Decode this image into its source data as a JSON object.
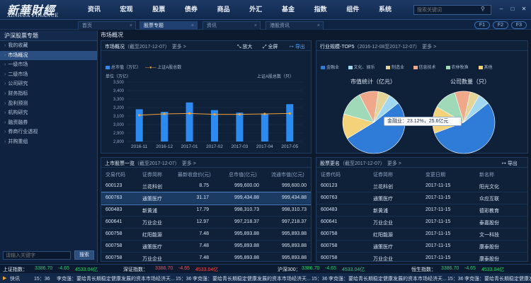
{
  "app": {
    "logo_cn": "新華財經",
    "logo_en": "XINHUA FINANCE"
  },
  "nav": [
    "资讯",
    "宏观",
    "股票",
    "债券",
    "商品",
    "外汇",
    "基金",
    "指数",
    "组件",
    "系统"
  ],
  "search": {
    "placeholder": "搜索关键词"
  },
  "tabs": [
    {
      "label": "首页",
      "active": false
    },
    {
      "label": "股票专题",
      "active": true
    },
    {
      "label": "资讯",
      "active": false
    },
    {
      "label": "港股资讯",
      "active": false
    }
  ],
  "fkeys": [
    "F1",
    "F2",
    "F3"
  ],
  "sidebar": {
    "title": "沪深股票专题",
    "items": [
      {
        "label": "我的收藏",
        "active": false
      },
      {
        "label": "市场概况",
        "active": true
      },
      {
        "label": "一级市场",
        "active": false
      },
      {
        "label": "二级市场",
        "active": false
      },
      {
        "label": "公司研究",
        "active": false
      },
      {
        "label": "财务指标",
        "active": false
      },
      {
        "label": "盈利预测",
        "active": false
      },
      {
        "label": "机构研究",
        "active": false
      },
      {
        "label": "融资融券",
        "active": false
      },
      {
        "label": "券商行业透视",
        "active": false
      },
      {
        "label": "并购重组",
        "active": false
      }
    ],
    "search_placeholder": "请输入关键字",
    "search_button": "搜索"
  },
  "main": {
    "section_title": "市场概况",
    "overview_panel": {
      "title": "市场概况",
      "subtitle": "（截至2017-12-07）",
      "more": "更多 >",
      "zoom": "放大",
      "fullscreen": "全屏",
      "export": "导出",
      "legend_left": "总市值（万亿）",
      "legend_right": "上证A股总数",
      "axis_left_unit": "单位（万亿）",
      "axis_right_unit": "上证A股总数（只）"
    },
    "top5_panel": {
      "title": "行业规模-TOP5",
      "subtitle": "（2016-12-08至2017-12-07）",
      "more": "更多 >",
      "legend": [
        {
          "name": "金融业",
          "color": "#2f7bd8"
        },
        {
          "name": "文化、娱乐",
          "color": "#9fd8f0"
        },
        {
          "name": "制造业",
          "color": "#e3d59a"
        },
        {
          "name": "信息技术",
          "color": "#f0a88a"
        },
        {
          "name": "农林牧渔",
          "color": "#9fd9b8"
        },
        {
          "name": "其他",
          "color": "#f3d27a"
        }
      ],
      "pie1_title": "市值统计（亿元）",
      "pie2_title": "公司数量（只）",
      "tooltip": "金融业：23.12%，25.6亿元"
    },
    "stock_table": {
      "title": "上市股票一览",
      "subtitle": "（截至2017-12-07）",
      "more": "更多 >",
      "columns": [
        "交易代码",
        "证券简称",
        "最新收盘价(元)",
        "总市值(亿元)",
        "流通市值(亿元)"
      ],
      "rows": [
        [
          "600123",
          "兰花科创",
          "8.75",
          "999,600.00",
          "999,600.00"
        ],
        [
          "600763",
          "通策医疗",
          "31.17",
          "999,434.88",
          "999,434.88"
        ],
        [
          "600483",
          "新黄浦",
          "17.79",
          "998,310.73",
          "998,310.73"
        ],
        [
          "600641",
          "万业企业",
          "12.97",
          "997,218.37",
          "997,218.37"
        ],
        [
          "600758",
          "红阳能源",
          "7.48",
          "995,893.88",
          "995,893.88"
        ],
        [
          "600758",
          "通策医疗",
          "7.48",
          "995,893.88",
          "995,893.88"
        ],
        [
          "600758",
          "万业企业",
          "7.48",
          "995,893.88",
          "995,893.88"
        ]
      ],
      "selected_index": 1
    },
    "rename_table": {
      "title": "股票更名",
      "subtitle": "（截至2017-12-07）",
      "more": "更多 >",
      "export": "导出",
      "columns": [
        "证券代码",
        "证券简称",
        "变更日期",
        "新名称"
      ],
      "rows": [
        [
          "600123",
          "兰花科创",
          "2017-11-15",
          "阳光文化"
        ],
        [
          "600763",
          "通策医疗",
          "2017-11-15",
          "众应互联"
        ],
        [
          "600483",
          "新黄浦",
          "2017-11-15",
          "德彩教育"
        ],
        [
          "600641",
          "万业企业",
          "2017-11-15",
          "泰嘉股份"
        ],
        [
          "600758",
          "红阳能源",
          "2017-11-15",
          "文一科技"
        ],
        [
          "600758",
          "通策医疗",
          "2017-11-15",
          "康泰股份"
        ],
        [
          "600758",
          "万业企业",
          "2017-11-15",
          "康泰股份"
        ]
      ]
    }
  },
  "status": {
    "indices": [
      {
        "label": "上证指数：",
        "value": "3386.70",
        "change": "-4.65",
        "volume": "4533.04亿"
      },
      {
        "label": "深证指数：",
        "value": "3386.70",
        "change": "-4.65",
        "volume": "4533.04亿"
      },
      {
        "label": "沪深300：",
        "value": "3386.70",
        "change": "-4.65",
        "volume": "4533.04亿"
      },
      {
        "label": "恒生指数：",
        "value": "3386.70",
        "change": "-4.65",
        "volume": "4533.04亿"
      }
    ],
    "news_label": "快讯",
    "news": [
      {
        "time": "15：36",
        "text": "李克强：要给青长期稳定健康发展的资本市场经济天..."
      },
      {
        "time": "15：36",
        "text": "李克强：要给青长期稳定健康发展的资本市场经济天..."
      },
      {
        "time": "15：36",
        "text": "李克强：要给青长期稳定健康发展的资本市场经济天..."
      },
      {
        "time": "15：36",
        "text": "李克强：要给青长期稳定健康发展的资本市场经济天..."
      }
    ]
  },
  "chart_data": [
    {
      "type": "bar",
      "categories": [
        "2016-11",
        "2016-12",
        "2017-01",
        "2017-02",
        "2017-03",
        "2017-04",
        "2017-05"
      ],
      "series": [
        {
          "name": "总市值（万亿）",
          "type": "bar",
          "values": [
            3180,
            3150,
            3260,
            3170,
            3140,
            3130,
            3240
          ],
          "color": "#2c8bf0"
        },
        {
          "name": "上证A股总数",
          "type": "line",
          "values": [
            3110,
            3125,
            3130,
            3120,
            3120,
            3125,
            3130
          ],
          "color": "#f2a23a"
        }
      ],
      "y_ticks": [
        "3,500",
        "3,400",
        "3,300",
        "3,200",
        "3,100",
        "3,000",
        "2,900",
        "2,800"
      ],
      "ylim": [
        2800,
        3500
      ]
    },
    {
      "type": "pie",
      "title": "市值统计（亿元）",
      "labels": [
        "金融业",
        "其他",
        "农林牧渔",
        "信息技术",
        "制造业",
        "文化、娱乐"
      ],
      "values": [
        52,
        13,
        13,
        10,
        6,
        6
      ],
      "colors": [
        "#2f7bd8",
        "#f3d27a",
        "#9fd9b8",
        "#f0a88a",
        "#e3d59a",
        "#9fd8f0"
      ]
    },
    {
      "type": "pie",
      "title": "公司数量（只）",
      "labels": [
        "金融业",
        "其他",
        "农林牧渔",
        "信息技术",
        "制造业",
        "文化、娱乐"
      ],
      "values": [
        55,
        14,
        12,
        8,
        5,
        6
      ],
      "colors": [
        "#2f7bd8",
        "#f3d27a",
        "#9fd9b8",
        "#f0a88a",
        "#e3d59a",
        "#9fd8f0"
      ]
    }
  ]
}
